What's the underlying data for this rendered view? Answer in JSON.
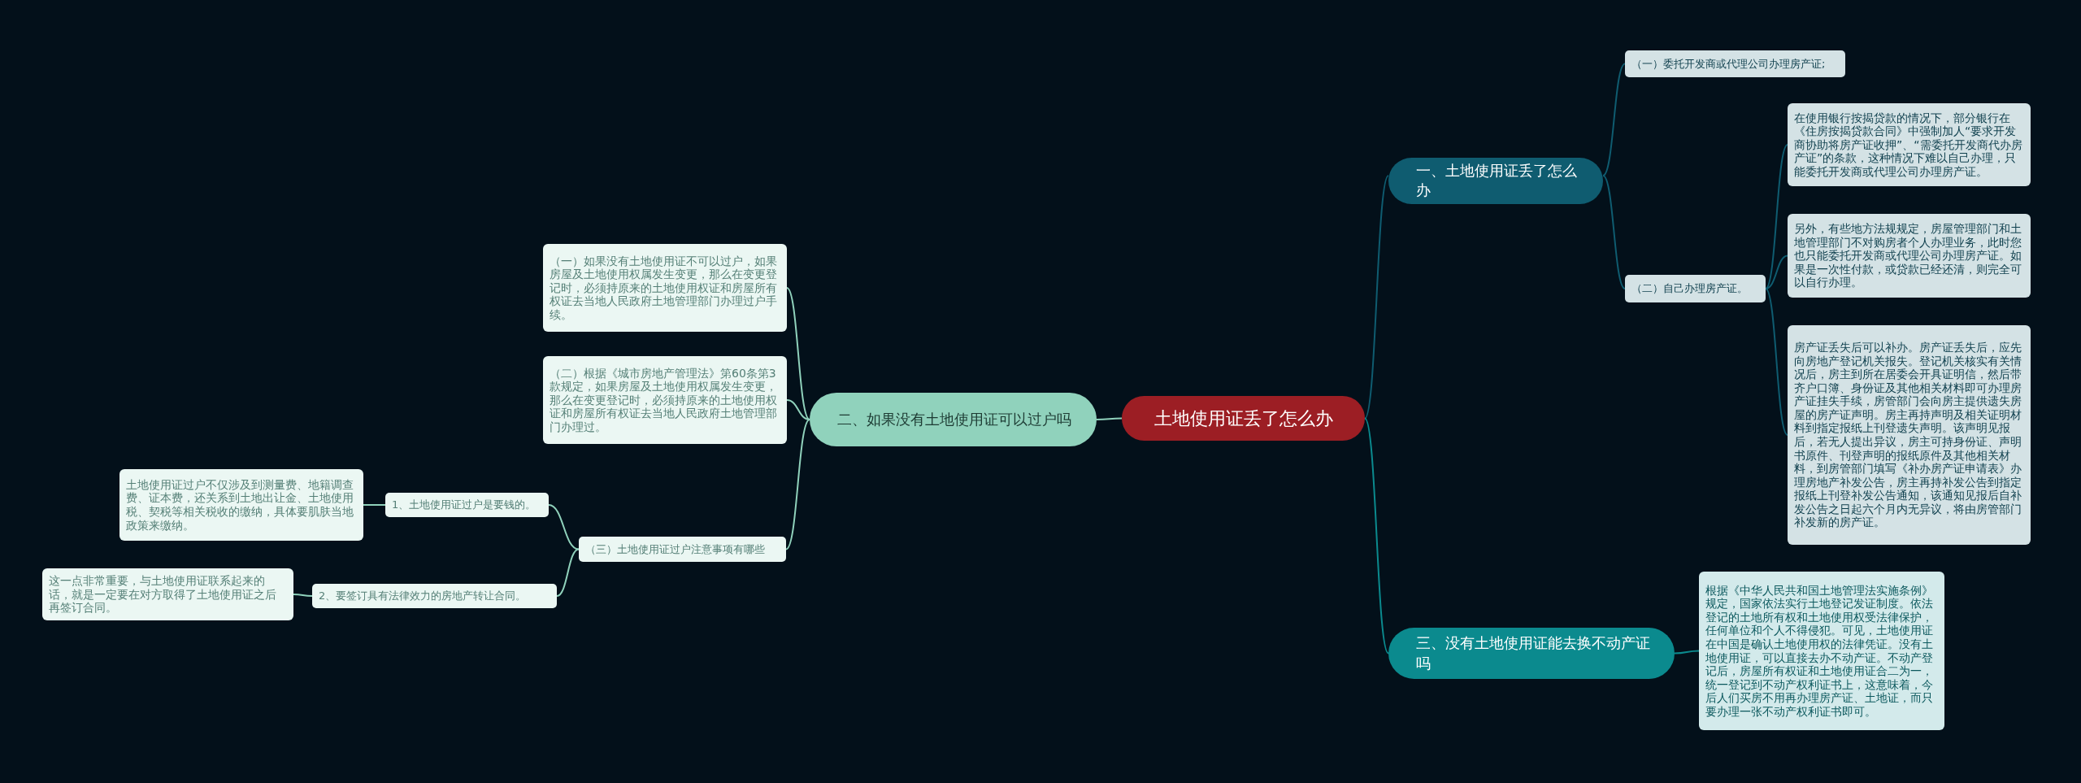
{
  "root": {
    "text": "土地使用证丢了怎么办",
    "color": "#9c1e24"
  },
  "branches": [
    {
      "text": "一、土地使用证丢了怎么办",
      "color": "#0f5c70",
      "children": [
        {
          "text": "（一）委托开发商或代理公司办理房产证;"
        },
        {
          "text": "（二）自己办理房产证。",
          "children": [
            {
              "text": "在使用银行按揭贷款的情况下，部分银行在《住房按揭贷款合同》中强制加人“要求开发商协助将房产证收押”、“需委托开发商代办房产证”的条款，这种情况下难以自己办理，只能委托开发商或代理公司办理房产证。"
            },
            {
              "text": "另外，有些地方法规规定，房屋管理部门和土地管理部门不对购房者个人办理业务，此时您也只能委托开发商或代理公司办理房产证。如果是一次性付款，或贷款已经还清，则完全可以自行办理。"
            },
            {
              "text": "房产证丢失后可以补办。房产证丢失后，应先向房地产登记机关报失。登记机关核实有关情况后，房主到所在居委会开具证明信，然后带齐户口簿、身份证及其他相关材料即可办理房产证挂失手续，房管部门会向房主提供遗失房屋的房产证声明。房主再持声明及相关证明材料到指定报纸上刊登遗失声明。该声明见报后，若无人提出异议，房主可持身份证、声明书原件、刊登声明的报纸原件及其他相关材料，到房管部门填写《补办房产证申请表》办理房地产补发公告，房主再持补发公告到指定报纸上刊登补发公告通知，该通知见报后自补发公告之日起六个月内无异议，将由房管部门补发新的房产证。"
            }
          ]
        }
      ]
    },
    {
      "text": "二、如果没有土地使用证可以过户吗",
      "color": "#90d2bc",
      "children": [
        {
          "text": "（一）如果没有土地使用证不可以过户，如果房屋及土地使用权属发生变更，那么在变更登记时，必须持原来的土地使用权证和房屋所有权证去当地人民政府土地管理部门办理过户手续。"
        },
        {
          "text": "（二）根据《城市房地产管理法》第60条第3款规定，如果房屋及土地使用权属发生变更，那么在变更登记时，必须持原来的土地使用权证和房屋所有权证去当地人民政府土地管理部门办理过。"
        },
        {
          "text": "（三）土地使用证过户注意事项有哪些",
          "children": [
            {
              "text": "1、土地使用证过户是要钱的。",
              "children": [
                {
                  "text": "土地使用证过户不仅涉及到测量费、地籍调查费、证本费，还关系到土地出让金、土地使用税、契税等相关税收的缴纳，具体要肌肤当地政策来缴纳。"
                }
              ]
            },
            {
              "text": "2、要签订具有法律效力的房地产转让合同。",
              "children": [
                {
                  "text": "这一点非常重要，与土地使用证联系起来的话，就是一定要在对方取得了土地使用证之后再签订合同。"
                }
              ]
            }
          ]
        }
      ]
    },
    {
      "text": "三、没有土地使用证能去换不动产证吗",
      "color": "#0b8a8e",
      "children": [
        {
          "text": "根据《中华人民共和国土地管理法实施条例》规定，国家依法实行土地登记发证制度。依法登记的土地所有权和土地使用权受法律保护，任何单位和个人不得侵犯。可见，土地使用证在中国是确认土地使用权的法律凭证。没有土地使用证，可以直接去办不动产证。不动产登记后，房屋所有权证和土地使用证合二为一，统一登记到不动产权利证书上，这意味着，今后人们买房不用再办理房产证、土地证，而只要办理一张不动产权利证书即可。"
        }
      ]
    }
  ]
}
